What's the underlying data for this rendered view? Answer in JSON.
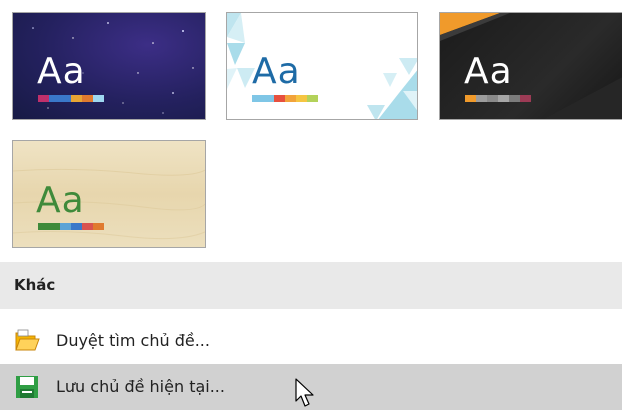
{
  "themes": [
    {
      "sample": "Aa",
      "swatches": [
        "#c0306b",
        "#3a78c9",
        "#3a78c9",
        "#e8a534",
        "#e07a2f",
        "#9fd8f0"
      ]
    },
    {
      "sample": "Aa",
      "swatches": [
        "#7fc6e6",
        "#7fc6e6",
        "#e7503e",
        "#f2a33a",
        "#f5c542",
        "#b3d25a"
      ]
    },
    {
      "sample": "Aa",
      "swatches": [
        "#f09a2b",
        "#9c9c9c",
        "#8a8a8a",
        "#a6a6a6",
        "#7c7c7c",
        "#9c3b55"
      ]
    },
    {
      "sample": "Aa",
      "swatches": [
        "#3f8a3a",
        "#3f8a3a",
        "#5ba3d6",
        "#3a78c9",
        "#d9534f",
        "#e07a2f"
      ]
    }
  ],
  "section": {
    "title": "Khác"
  },
  "menu": {
    "browse_label": "Duyệt tìm chủ đề...",
    "save_label": "Lưu chủ đề hiện tại..."
  },
  "icons": {
    "browse": "folder-open-icon",
    "save": "save-floppy-icon",
    "cursor": "mouse-pointer-icon"
  }
}
